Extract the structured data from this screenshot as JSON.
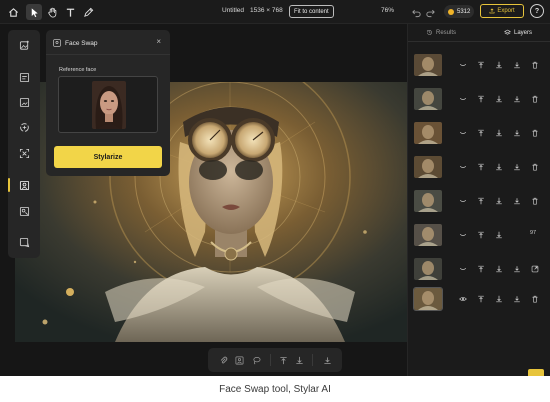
{
  "app": {
    "document_title": "Untitled",
    "document_size": "1536 × 768",
    "fit_button_label": "Fit to content",
    "zoom_level": "76%",
    "credits": "5312",
    "export_label": "Export",
    "help_label": "?",
    "brand_color": "#e7c43b"
  },
  "toolbar_top": {
    "icons": [
      "home-icon",
      "cursor-icon",
      "hand-icon",
      "text-icon",
      "pen-icon"
    ],
    "active": "cursor-icon"
  },
  "left_toolbar": {
    "icons": [
      "add-image-icon",
      "generate-image-icon",
      "edit-image-icon",
      "magic-icon",
      "expand-icon",
      "face-swap-icon",
      "style-icon",
      "crop-icon"
    ],
    "active": "face-swap-icon"
  },
  "face_swap_panel": {
    "title": "Face Swap",
    "close_label": "×",
    "reference_label": "Reference face",
    "button_label": "Stylarize"
  },
  "right_panel": {
    "tabs": [
      {
        "label": "Results",
        "icon": "history-icon"
      },
      {
        "label": "Layers",
        "icon": "layers-icon"
      }
    ],
    "active_tab": "Layers",
    "layers": [
      {
        "text": "",
        "icons": [
          "download-icon",
          "trash-icon"
        ],
        "selected": false
      },
      {
        "text": "",
        "icons": [
          "download-icon",
          "trash-icon"
        ],
        "selected": false
      },
      {
        "text": "",
        "icons": [
          "download-icon",
          "trash-icon"
        ],
        "selected": false
      },
      {
        "text": "",
        "icons": [
          "download-icon",
          "trash-icon"
        ],
        "selected": false
      },
      {
        "text": "",
        "icons": [
          "download-icon",
          "trash-icon"
        ],
        "selected": false
      },
      {
        "text": "97",
        "icons": [],
        "selected": false
      },
      {
        "text": "",
        "icons": [
          "download-icon",
          "external-icon"
        ],
        "selected": false
      },
      {
        "text": "",
        "icons": [
          "download-icon",
          "trash-icon"
        ],
        "selected": true
      }
    ]
  },
  "bottom_toolbar": {
    "icons": [
      "attach-icon",
      "person-icon",
      "lasso-icon",
      "align-top-icon",
      "align-bottom-icon",
      "download-icon"
    ]
  },
  "caption": "Face Swap tool, Stylar AI"
}
